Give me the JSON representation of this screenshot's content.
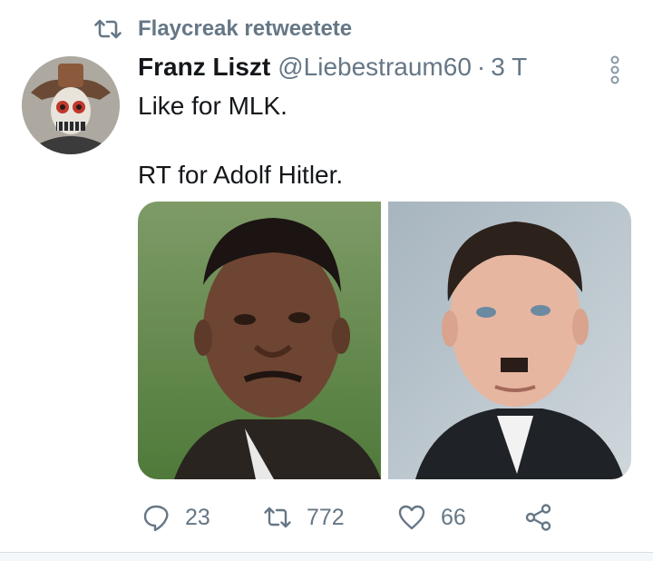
{
  "retweet_context": {
    "label": "Flaycreak retweetete",
    "icon": "retweet-icon"
  },
  "tweet": {
    "author_name": "Franz Liszt",
    "author_handle": "@Liebestraum60",
    "separator": "·",
    "time_ago": "3 T",
    "text_line1": "Like for MLK.",
    "text_line2": "RT for Adolf Hitler."
  },
  "media": [
    {
      "subject": "portrait-photo-left"
    },
    {
      "subject": "portrait-photo-right"
    }
  ],
  "actions": {
    "reply_count": "23",
    "retweet_count": "772",
    "like_count": "66"
  },
  "colors": {
    "secondary_text": "#657786",
    "primary_text": "#14171a",
    "divider": "#d8dde2"
  }
}
